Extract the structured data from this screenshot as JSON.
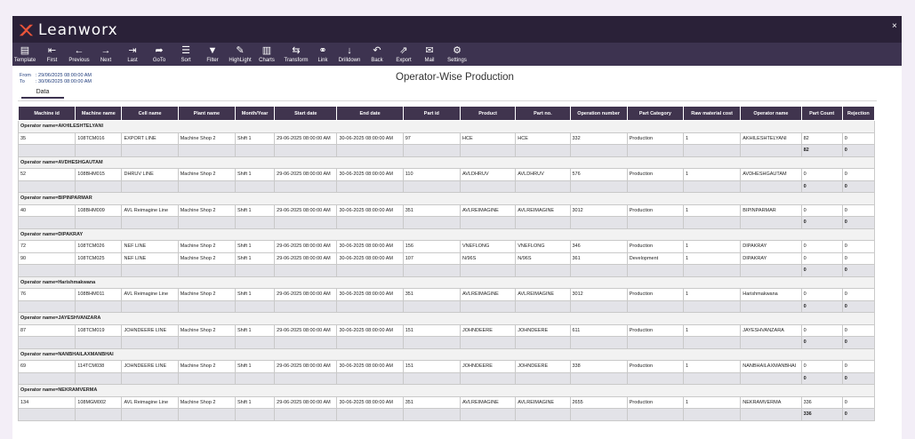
{
  "app": {
    "brand": "Leanworx",
    "close_label": "×"
  },
  "toolbar": [
    {
      "label": "Template",
      "icon": "template-icon",
      "glyph": "▤"
    },
    {
      "label": "First",
      "icon": "first-icon",
      "glyph": "⇤"
    },
    {
      "label": "Previous",
      "icon": "previous-icon",
      "glyph": "←"
    },
    {
      "label": "Next",
      "icon": "next-icon",
      "glyph": "→"
    },
    {
      "label": "Last",
      "icon": "last-icon",
      "glyph": "⇥"
    },
    {
      "label": "GoTo",
      "icon": "goto-icon",
      "glyph": "➦"
    },
    {
      "label": "Sort",
      "icon": "sort-icon",
      "glyph": "☰"
    },
    {
      "label": "Filter",
      "icon": "filter-icon",
      "glyph": "▼"
    },
    {
      "label": "HighLight",
      "icon": "highlight-icon",
      "glyph": "✎"
    },
    {
      "label": "Charts",
      "icon": "charts-icon",
      "glyph": "▥"
    },
    {
      "label": "Transform",
      "icon": "transform-icon",
      "glyph": "⇆"
    },
    {
      "label": "Link",
      "icon": "link-icon",
      "glyph": "⚭"
    },
    {
      "label": "Drilldown",
      "icon": "drilldown-icon",
      "glyph": "↓"
    },
    {
      "label": "Back",
      "icon": "back-icon",
      "glyph": "↶"
    },
    {
      "label": "Export",
      "icon": "export-icon",
      "glyph": "⇗"
    },
    {
      "label": "Mail",
      "icon": "mail-icon",
      "glyph": "✉"
    },
    {
      "label": "Settings",
      "icon": "settings-icon",
      "glyph": "⚙"
    }
  ],
  "range": {
    "from_label": "From",
    "from_value": ": 29/06/2025 08:00:00 AM",
    "to_label": "To",
    "to_value": ": 30/06/2025 08:00:00 AM"
  },
  "report": {
    "title": "Operator-Wise Production"
  },
  "tabs": [
    {
      "label": "Data"
    }
  ],
  "table": {
    "columns": [
      "Machine id",
      "Machine name",
      "Cell name",
      "Plant name",
      "Month/Year",
      "Start date",
      "End date",
      "Part id",
      "Product",
      "Part no.",
      "Operation number",
      "Part Category",
      "Raw material cost",
      "Operator name",
      "Part Count",
      "Rejection"
    ],
    "groups": [
      {
        "header": "Operator name=AKHILESHTELYANI",
        "rows": [
          [
            "35",
            "108TCM016",
            "EXPORT LINE",
            "Machine Shop 2",
            "Shift 1",
            "29-06-2025 08:00:00 AM",
            "30-06-2025 08:00:00 AM",
            "97",
            "HCE",
            "HCE",
            "332",
            "Production",
            "1",
            "AKHILESHTELYANI",
            "82",
            "0"
          ]
        ],
        "totals": [
          "82",
          "0"
        ]
      },
      {
        "header": "Operator name=AVDHESHGAUTAM",
        "rows": [
          [
            "52",
            "108BHM015",
            "DHRUV LINE",
            "Machine Shop 2",
            "Shift 1",
            "29-06-2025 08:00:00 AM",
            "30-06-2025 08:00:00 AM",
            "110",
            "AVLDHRUV",
            "AVLDHRUV",
            "576",
            "Production",
            "1",
            "AVDHESHGAUTAM",
            "0",
            "0"
          ]
        ],
        "totals": [
          "0",
          "0"
        ]
      },
      {
        "header": "Operator name=BIPINPARMAR",
        "rows": [
          [
            "40",
            "108BHM009",
            "AVL Reimagine Line",
            "Machine Shop 2",
            "Shift 1",
            "29-06-2025 08:00:00 AM",
            "30-06-2025 08:00:00 AM",
            "351",
            "AVLREIMAGINE",
            "AVLREIMAGINE",
            "3012",
            "Production",
            "1",
            "BIPINPARMAR",
            "0",
            "0"
          ]
        ],
        "totals": [
          "0",
          "0"
        ]
      },
      {
        "header": "Operator name=DIPAKRAY",
        "rows": [
          [
            "72",
            "108TCM026",
            "NEF LINE",
            "Machine Shop 2",
            "Shift 1",
            "29-06-2025 08:00:00 AM",
            "30-06-2025 08:00:00 AM",
            "156",
            "VNEFLONG",
            "VNEFLONG",
            "346",
            "Production",
            "1",
            "DIPAKRAY",
            "0",
            "0"
          ],
          [
            "90",
            "108TCM025",
            "NEF LINE",
            "Machine Shop 2",
            "Shift 1",
            "29-06-2025 08:00:00 AM",
            "30-06-2025 08:00:00 AM",
            "107",
            "N/96S",
            "N/96S",
            "361",
            "Development",
            "1",
            "DIPAKRAY",
            "0",
            "0"
          ]
        ],
        "totals": [
          "0",
          "0"
        ]
      },
      {
        "header": "Operator name=Harishmakwana",
        "rows": [
          [
            "76",
            "108BHM011",
            "AVL Reimagine Line",
            "Machine Shop 2",
            "Shift 1",
            "29-06-2025 08:00:00 AM",
            "30-06-2025 08:00:00 AM",
            "351",
            "AVLREIMAGINE",
            "AVLREIMAGINE",
            "3012",
            "Production",
            "1",
            "Harishmakwana",
            "0",
            "0"
          ]
        ],
        "totals": [
          "0",
          "0"
        ]
      },
      {
        "header": "Operator name=JAYESHVANZARA",
        "rows": [
          [
            "87",
            "108TCM019",
            "JOHNDEERE LINE",
            "Machine Shop 2",
            "Shift 1",
            "29-06-2025 08:00:00 AM",
            "30-06-2025 08:00:00 AM",
            "151",
            "JOHNDEERE",
            "JOHNDEERE",
            "611",
            "Production",
            "1",
            "JAYESHVANZARA",
            "0",
            "0"
          ]
        ],
        "totals": [
          "0",
          "0"
        ]
      },
      {
        "header": "Operator name=NANBHAILAXMANBHAI",
        "rows": [
          [
            "69",
            "114TCM038",
            "JOHNDEERE LINE",
            "Machine Shop 2",
            "Shift 1",
            "29-06-2025 08:00:00 AM",
            "30-06-2025 08:00:00 AM",
            "151",
            "JOHNDEERE",
            "JOHNDEERE",
            "338",
            "Production",
            "1",
            "NANBHAILAXMANBHAI",
            "0",
            "0"
          ]
        ],
        "totals": [
          "0",
          "0"
        ]
      },
      {
        "header": "Operator name=NEKRAMVERMA",
        "rows": [
          [
            "134",
            "108MGM002",
            "AVL Reimagine Line",
            "Machine Shop 2",
            "Shift 1",
            "29-06-2025 08:00:00 AM",
            "30-06-2025 08:00:00 AM",
            "351",
            "AVLREIMAGINE",
            "AVLREIMAGINE",
            "2655",
            "Production",
            "1",
            "NEKRAMVERMA",
            "336",
            "0"
          ]
        ],
        "totals": [
          "336",
          "0"
        ]
      }
    ]
  },
  "colors": {
    "titlebar": "#2a2138",
    "toolbar": "#3d3350",
    "header": "#40344e",
    "logo_accent": "#e8543a"
  }
}
